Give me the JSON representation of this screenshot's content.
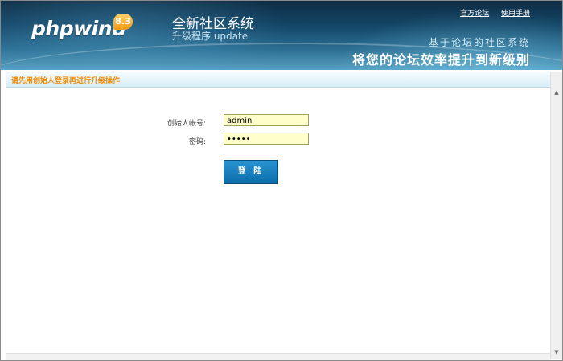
{
  "header": {
    "logo_text": "phpwind",
    "logo_badge": "8.3",
    "title_main": "全新社区系统",
    "title_sub": "升级程序 update",
    "links": [
      "官方论坛",
      "使用手册"
    ],
    "slogan_small": "基于论坛的社区系统",
    "slogan_big": "将您的论坛效率提升到新级别"
  },
  "notice": {
    "text": "请先用创始人登录再进行升级操作"
  },
  "form": {
    "account_label": "创始人帐号:",
    "account_value": "admin",
    "password_label": "密码:",
    "password_value": "•••••",
    "login_label": "登 陆"
  },
  "colors": {
    "header_dark": "#0f2d45",
    "header_light": "#58a0c0",
    "notice_text": "#f08a00",
    "input_bg": "#ffffcc",
    "button_bg": "#0b6eaa"
  },
  "icons": {
    "scroll_up": "arrow-up-icon",
    "scroll_down": "arrow-down-icon"
  }
}
